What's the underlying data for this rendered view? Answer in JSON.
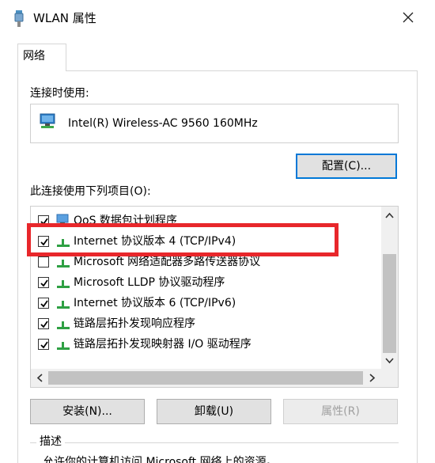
{
  "window": {
    "title": "WLAN 属性",
    "close_icon": "close-icon"
  },
  "tabs": [
    {
      "label": "网络",
      "active": true
    }
  ],
  "connect_using": {
    "label": "连接时使用:",
    "adapter_name": "Intel(R) Wireless-AC 9560 160MHz",
    "adapter_icon": "network-adapter-icon"
  },
  "buttons": {
    "configure": "配置(C)...",
    "install": "安装(N)...",
    "uninstall": "卸载(U)",
    "properties": "属性(R)"
  },
  "items_label": "此连接使用下列项目(O):",
  "items": [
    {
      "label": "QoS 数据包计划程序",
      "checked": true,
      "icon": "network-service-icon"
    },
    {
      "label": "Internet 协议版本 4 (TCP/IPv4)",
      "checked": true,
      "icon": "network-protocol-icon"
    },
    {
      "label": "Microsoft 网络适配器多路传送器协议",
      "checked": false,
      "icon": "network-protocol-icon"
    },
    {
      "label": "Microsoft LLDP 协议驱动程序",
      "checked": true,
      "icon": "network-protocol-icon"
    },
    {
      "label": "Internet 协议版本 6 (TCP/IPv6)",
      "checked": true,
      "icon": "network-protocol-icon"
    },
    {
      "label": "链路层拓扑发现响应程序",
      "checked": true,
      "icon": "network-protocol-icon"
    },
    {
      "label": "链路层拓扑发现映射器 I/O 驱动程序",
      "checked": true,
      "icon": "network-protocol-icon"
    }
  ],
  "description": {
    "title": "描述",
    "text": "允许你的计算机访问 Microsoft 网络上的资源。"
  },
  "colors": {
    "highlight": "#e8272b",
    "focus_border": "#0078d7",
    "protocol_green": "#2ea043"
  }
}
